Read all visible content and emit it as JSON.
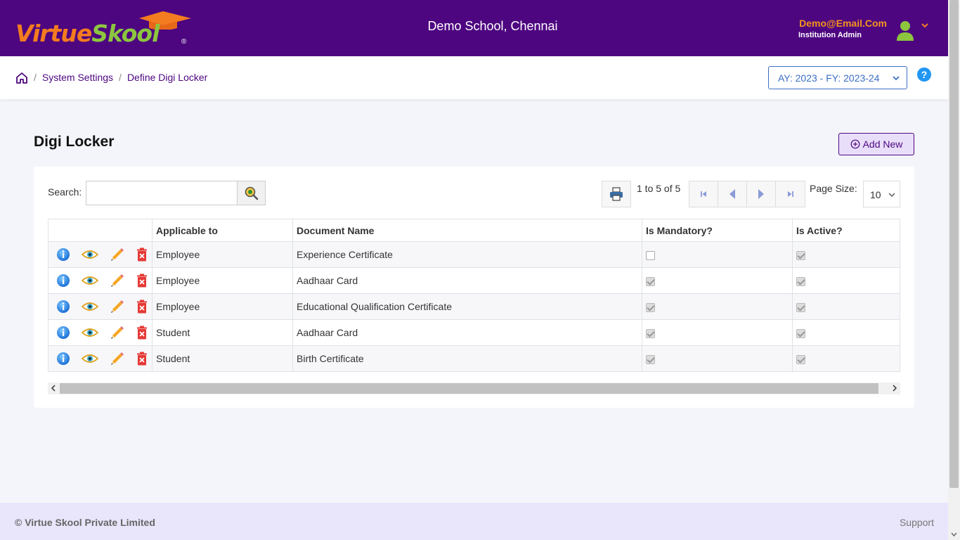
{
  "header": {
    "logo_virtue": "Virtue",
    "logo_skool": "Skool",
    "logo_reg": "®",
    "school_name": "Demo School, Chennai",
    "user_email": "Demo@Email.Com",
    "user_role": "Institution Admin"
  },
  "breadcrumb": {
    "items": [
      "System Settings",
      "Define Digi Locker"
    ],
    "separator": "/"
  },
  "academic_year": "AY: 2023 - FY: 2023-24",
  "help": "?",
  "page": {
    "title": "Digi Locker",
    "add_label": "Add New"
  },
  "toolbar": {
    "search_label": "Search:",
    "search_placeholder": "",
    "page_info": "1 to 5 of 5",
    "page_size_label": "Page Size:",
    "page_size": "10"
  },
  "table": {
    "columns": [
      "",
      "Applicable to",
      "Document Name",
      "Is Mandatory?",
      "Is Active?"
    ],
    "rows": [
      {
        "applicable_to": "Employee",
        "document": "Experience Certificate",
        "mandatory": false,
        "active": true
      },
      {
        "applicable_to": "Employee",
        "document": "Aadhaar Card",
        "mandatory": true,
        "active": true
      },
      {
        "applicable_to": "Employee",
        "document": "Educational Qualification Certificate",
        "mandatory": true,
        "active": true
      },
      {
        "applicable_to": "Student",
        "document": "Aadhaar Card",
        "mandatory": true,
        "active": true
      },
      {
        "applicable_to": "Student",
        "document": "Birth Certificate",
        "mandatory": true,
        "active": true
      }
    ]
  },
  "footer": {
    "copyright": "© Virtue Skool Private Limited",
    "support": "Support"
  },
  "colors": {
    "brand_purple": "#4d0680",
    "brand_orange": "#f47c20",
    "brand_green": "#8cc63f",
    "accent_blue": "#3a6fc4"
  },
  "icons": [
    "graduation-cap-icon",
    "user-avatar-icon",
    "chevron-down-icon",
    "home-icon",
    "help-icon",
    "plus-circle-icon",
    "search-icon",
    "printer-icon",
    "first-page-icon",
    "previous-page-icon",
    "next-page-icon",
    "last-page-icon",
    "info-icon",
    "view-eye-icon",
    "edit-pencil-icon",
    "delete-icon"
  ]
}
